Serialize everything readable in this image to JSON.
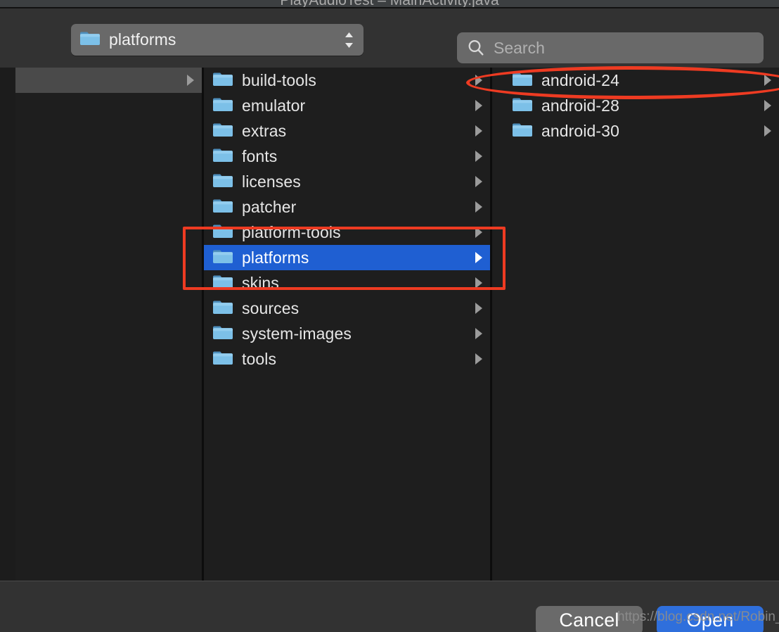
{
  "ide": {
    "title": "PlayAudioTest – MainActivity.java"
  },
  "toolbar": {
    "path_popup": {
      "label": "platforms",
      "icon": "folder-icon",
      "chevrons_icon": "chevron-up-down-icon"
    },
    "search": {
      "placeholder": "Search",
      "value": "",
      "icon": "search-icon"
    }
  },
  "browser": {
    "columns": [
      {
        "name": "column-1",
        "rows": [
          {
            "label": "",
            "selected": "grey",
            "has_arrow": true,
            "show_folder": false
          }
        ]
      },
      {
        "name": "column-2",
        "rows": [
          {
            "label": "build-tools",
            "selected": "none",
            "has_arrow": true,
            "show_folder": true
          },
          {
            "label": "emulator",
            "selected": "none",
            "has_arrow": true,
            "show_folder": true
          },
          {
            "label": "extras",
            "selected": "none",
            "has_arrow": true,
            "show_folder": true
          },
          {
            "label": "fonts",
            "selected": "none",
            "has_arrow": true,
            "show_folder": true
          },
          {
            "label": "licenses",
            "selected": "none",
            "has_arrow": true,
            "show_folder": true
          },
          {
            "label": "patcher",
            "selected": "none",
            "has_arrow": true,
            "show_folder": true
          },
          {
            "label": "platform-tools",
            "selected": "none",
            "has_arrow": true,
            "show_folder": true
          },
          {
            "label": "platforms",
            "selected": "blue",
            "has_arrow": true,
            "show_folder": true
          },
          {
            "label": "skins",
            "selected": "none",
            "has_arrow": true,
            "show_folder": true
          },
          {
            "label": "sources",
            "selected": "none",
            "has_arrow": true,
            "show_folder": true
          },
          {
            "label": "system-images",
            "selected": "none",
            "has_arrow": true,
            "show_folder": true
          },
          {
            "label": "tools",
            "selected": "none",
            "has_arrow": true,
            "show_folder": true
          }
        ]
      },
      {
        "name": "column-3",
        "rows": [
          {
            "label": "android-24",
            "selected": "none",
            "has_arrow": true,
            "show_folder": true
          },
          {
            "label": "android-28",
            "selected": "none",
            "has_arrow": true,
            "show_folder": true
          },
          {
            "label": "android-30",
            "selected": "none",
            "has_arrow": true,
            "show_folder": true
          }
        ]
      }
    ]
  },
  "footer": {
    "cancel_label": "Cancel",
    "open_label": "Open"
  },
  "annotations": {
    "rect_target": "platform-tools / platforms / skins rows",
    "ellipse_target": "android-24 row",
    "accent_color": "#ee3b22"
  },
  "watermark": {
    "text": "https://blog.csdn.net/Robin_Pi"
  },
  "colors": {
    "sheet_bg": "#323232",
    "list_bg": "#1e1e1e",
    "selection_blue": "#1f5fd2",
    "selection_grey": "#4a4a4a",
    "open_button_blue": "#2f6fdc",
    "cancel_button_grey": "#6a6a6a",
    "folder_blue": "#6fb4e0",
    "annotation_red": "#ee3b22"
  }
}
